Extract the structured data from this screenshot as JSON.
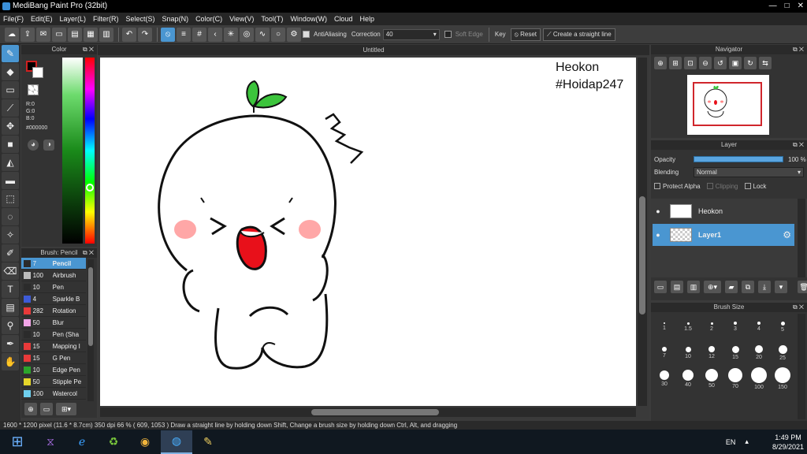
{
  "window": {
    "title": "MediBang Paint Pro (32bit)",
    "controls": [
      "—",
      "□",
      "✕"
    ]
  },
  "menu": [
    "File(F)",
    "Edit(E)",
    "Layer(L)",
    "Filter(R)",
    "Select(S)",
    "Snap(N)",
    "Color(C)",
    "View(V)",
    "Tool(T)",
    "Window(W)",
    "Cloud",
    "Help"
  ],
  "toolbar": {
    "antialiasing_label": "AntiAliasing",
    "correction_label": "Correction",
    "correction_value": "40",
    "soft_edge_label": "Soft Edge",
    "key_label": "Key",
    "reset_label": "Reset",
    "straight_line_label": "Create a straight line"
  },
  "color_panel": {
    "title": "Color",
    "rgb_r": "R:0",
    "rgb_g": "G:0",
    "rgb_b": "B:0",
    "hex": "#000000"
  },
  "brush_panel": {
    "title": "Brush: Pencil",
    "items": [
      {
        "size": "7",
        "name": "Pencil",
        "color": "#2b2b2b",
        "selected": true
      },
      {
        "size": "100",
        "name": "Airbrush",
        "color": "#bdbdbd"
      },
      {
        "size": "10",
        "name": "Pen",
        "color": "#2b2b2b"
      },
      {
        "size": "4",
        "name": "Sparkle B",
        "color": "#3d5bd8"
      },
      {
        "size": "282",
        "name": "Rotation",
        "color": "#e83a3a"
      },
      {
        "size": "50",
        "name": "Blur",
        "color": "#f2a5e8"
      },
      {
        "size": "10",
        "name": "Pen (Sha",
        "color": "#2b2b2b"
      },
      {
        "size": "15",
        "name": "Mapping I",
        "color": "#e83a3a"
      },
      {
        "size": "15",
        "name": "G Pen",
        "color": "#e83a3a"
      },
      {
        "size": "10",
        "name": "Edge Pen",
        "color": "#2ba52b"
      },
      {
        "size": "50",
        "name": "Stipple Pe",
        "color": "#e6d62a"
      },
      {
        "size": "100",
        "name": "Watercol",
        "color": "#6fd0ef"
      }
    ]
  },
  "canvas": {
    "tab_title": "Untitled",
    "watermark_line1": "Heokon",
    "watermark_line2": "#Hoidap247"
  },
  "navigator": {
    "title": "Navigator"
  },
  "layer_panel": {
    "title": "Layer",
    "opacity_label": "Opacity",
    "opacity_value": "100 %",
    "opacity": 1.0,
    "blending_label": "Blending",
    "blending_value": "Normal",
    "protect_alpha": "Protect Alpha",
    "clipping": "Clipping",
    "lock": "Lock",
    "layers": [
      {
        "name": "Heokon",
        "selected": false
      },
      {
        "name": "Layer1",
        "selected": true
      }
    ]
  },
  "brush_size": {
    "title": "Brush Size",
    "sizes": [
      "1",
      "1.5",
      "2",
      "3",
      "4",
      "5",
      "7",
      "10",
      "12",
      "15",
      "20",
      "25",
      "30",
      "40",
      "50",
      "70",
      "100",
      "150"
    ]
  },
  "status": {
    "text": "1600 * 1200 pixel   (11.6 * 8.7cm)   350 dpi   66 %   ( 609, 1053 )   Draw a straight line by holding down Shift, Change a brush size by holding down Ctrl, Alt, and dragging"
  },
  "taskbar": {
    "lang": "EN",
    "time": "1:49 PM",
    "date": "8/29/2021"
  },
  "colors": {
    "accent": "#4a96d1",
    "panel": "#333333",
    "blush": "#ff6b6b",
    "leaf": "#3cc43c",
    "mouth": "#e8101a"
  }
}
